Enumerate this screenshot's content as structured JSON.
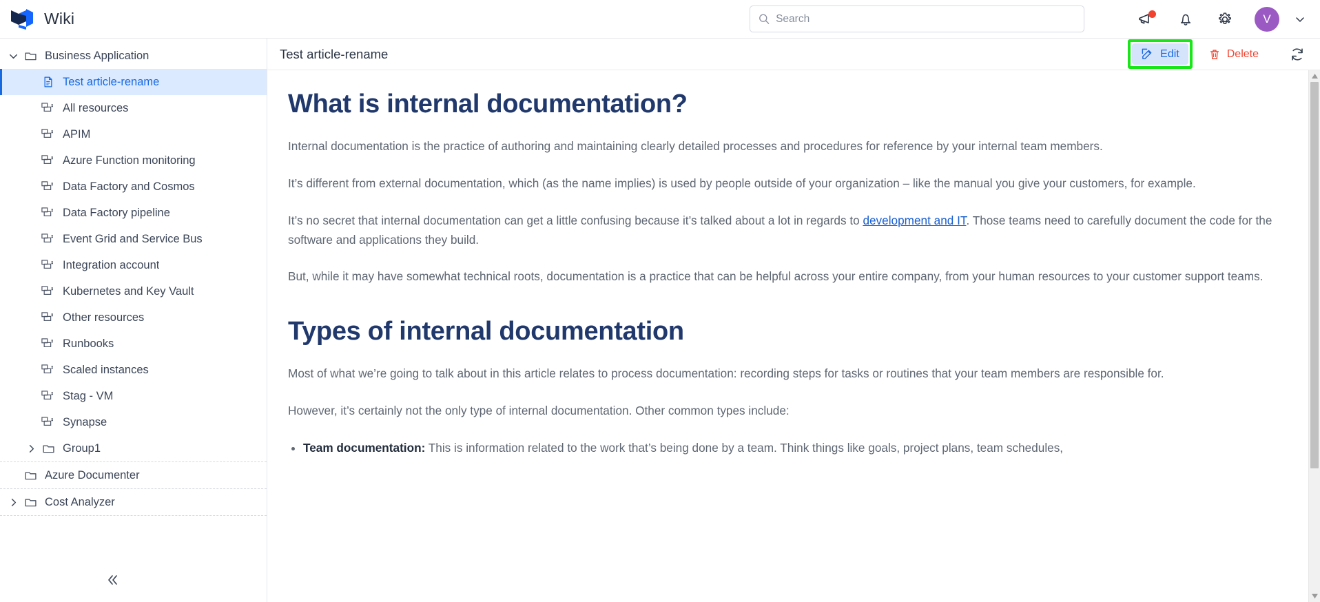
{
  "app": {
    "title": "Wiki",
    "logo_dark": "#16274d",
    "logo_blue": "#1565ff"
  },
  "header": {
    "search": {
      "placeholder": "Search",
      "value": "",
      "icon": "search-icon"
    },
    "icons": [
      {
        "name": "megaphone-icon",
        "badge": true,
        "badge_color": "#f0422f"
      },
      {
        "name": "bell-icon",
        "badge": false
      },
      {
        "name": "gear-icon",
        "badge": false
      }
    ],
    "avatar": {
      "initial": "V",
      "color": "#9b59c4"
    },
    "caret": "chevron-down-icon"
  },
  "sidebar": {
    "collapse_label": "«",
    "items": [
      {
        "label": "Business Application",
        "icon": "folder-icon",
        "chevron": "expanded",
        "indent": 0,
        "selected": false,
        "divider_after": false
      },
      {
        "label": "Test article-rename",
        "icon": "document-icon",
        "chevron": "none",
        "indent": 1,
        "selected": true,
        "divider_after": false
      },
      {
        "label": "All resources",
        "icon": "diagram-icon",
        "chevron": "none",
        "indent": 1,
        "selected": false,
        "divider_after": false
      },
      {
        "label": "APIM",
        "icon": "diagram-icon",
        "chevron": "none",
        "indent": 1,
        "selected": false,
        "divider_after": false
      },
      {
        "label": "Azure Function monitoring",
        "icon": "diagram-icon",
        "chevron": "none",
        "indent": 1,
        "selected": false,
        "divider_after": false
      },
      {
        "label": "Data Factory and Cosmos",
        "icon": "diagram-icon",
        "chevron": "none",
        "indent": 1,
        "selected": false,
        "divider_after": false
      },
      {
        "label": "Data Factory pipeline",
        "icon": "diagram-icon",
        "chevron": "none",
        "indent": 1,
        "selected": false,
        "divider_after": false
      },
      {
        "label": "Event Grid and Service Bus",
        "icon": "diagram-icon",
        "chevron": "none",
        "indent": 1,
        "selected": false,
        "divider_after": false
      },
      {
        "label": "Integration account",
        "icon": "diagram-icon",
        "chevron": "none",
        "indent": 1,
        "selected": false,
        "divider_after": false
      },
      {
        "label": "Kubernetes and Key Vault",
        "icon": "diagram-icon",
        "chevron": "none",
        "indent": 1,
        "selected": false,
        "divider_after": false
      },
      {
        "label": "Other resources",
        "icon": "diagram-icon",
        "chevron": "none",
        "indent": 1,
        "selected": false,
        "divider_after": false
      },
      {
        "label": "Runbooks",
        "icon": "diagram-icon",
        "chevron": "none",
        "indent": 1,
        "selected": false,
        "divider_after": false
      },
      {
        "label": "Scaled instances",
        "icon": "diagram-icon",
        "chevron": "none",
        "indent": 1,
        "selected": false,
        "divider_after": false
      },
      {
        "label": "Stag - VM",
        "icon": "diagram-icon",
        "chevron": "none",
        "indent": 1,
        "selected": false,
        "divider_after": false
      },
      {
        "label": "Synapse",
        "icon": "diagram-icon",
        "chevron": "none",
        "indent": 1,
        "selected": false,
        "divider_after": false
      },
      {
        "label": "Group1",
        "icon": "folder-icon",
        "chevron": "collapsed",
        "indent": 1,
        "selected": false,
        "divider_after": true
      },
      {
        "label": "Azure Documenter",
        "icon": "folder-icon",
        "chevron": "none",
        "indent": 0,
        "selected": false,
        "divider_after": true
      },
      {
        "label": "Cost Analyzer",
        "icon": "folder-icon",
        "chevron": "collapsed",
        "indent": 0,
        "selected": false,
        "divider_after": true
      }
    ]
  },
  "article": {
    "title": "Test article-rename",
    "toolbar": {
      "edit_label": "Edit",
      "edit_icon": "edit-pencil-icon",
      "delete_label": "Delete",
      "delete_icon": "trash-icon",
      "refresh_icon": "refresh-icon",
      "edit_highlight_color": "#19e619"
    },
    "heading1": "What is internal documentation?",
    "p1": "Internal documentation is the practice of authoring and maintaining clearly detailed processes and procedures for reference by your internal team members.",
    "p2": "It’s different from external documentation, which (as the name implies) is used by people outside of your organization – like the manual you give your customers, for example.",
    "p3_before": "It’s no secret that internal documentation can get a little confusing because it’s talked about a lot in regards to ",
    "p3_link": "development and IT",
    "p3_after": ". Those teams need to carefully document the code for the software and applications they build.",
    "p4": "But, while it may have somewhat technical roots, documentation is a practice that can be helpful across your entire company, from your human resources to your customer support teams.",
    "heading2": "Types of internal documentation",
    "p5": "Most of what we’re going to talk about in this article relates to process documentation: recording steps for tasks or routines that your team members are responsible for.",
    "p6": "However, it’s certainly not the only type of internal documentation. Other common types include:",
    "bullet1_bold": "Team documentation:",
    "bullet1_text": " This is information related to the work that’s being done by a team. Think things like goals, project plans, team schedules,"
  },
  "scrollbar": {
    "up_icon": "triangle-up-icon",
    "down_icon": "triangle-down-icon",
    "thumb_position_pct": 0
  }
}
